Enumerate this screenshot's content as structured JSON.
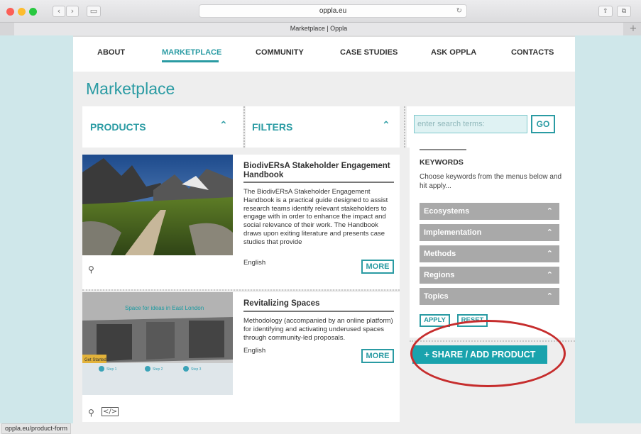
{
  "browser": {
    "url": "oppla.eu",
    "tab_title": "Marketplace | Oppla",
    "back_icon": "‹",
    "forward_icon": "›",
    "sidebar_icon": "▭",
    "reload_icon": "↻",
    "share_icon": "⇪",
    "tabs_icon": "⧉",
    "new_tab_icon": "+"
  },
  "nav": {
    "items": [
      "ABOUT",
      "MARKETPLACE",
      "COMMUNITY",
      "CASE STUDIES",
      "ASK OPPLA",
      "CONTACTS"
    ],
    "active": "MARKETPLACE"
  },
  "page_title": "Marketplace",
  "panels": {
    "products_label": "PRODUCTS",
    "filters_label": "FILTERS",
    "chevron": "⌃"
  },
  "search": {
    "placeholder": "enter search terms:",
    "go_label": "GO"
  },
  "products": [
    {
      "title": "BiodivERsA Stakeholder Engagement Handbook",
      "description": "The BiodivERsA Stakeholder Engagement Handbook is a practical guide designed to assist research teams identify relevant stakeholders to engage with in order to enhance the impact and social relevance of their work. The Handbook draws upon exiting literature and presents case studies that provide",
      "language": "English",
      "more_label": "MORE",
      "icons": [
        "signpost-icon"
      ]
    },
    {
      "title": "Revitalizing Spaces",
      "description": "Methodology (accompanied by an online platform) for identifying and activating underused spaces through community-led proposals.",
      "language": "English",
      "more_label": "MORE",
      "icons": [
        "signpost-icon",
        "code-icon"
      ],
      "image_caption": "Space for ideas in East London",
      "image_tag": "Get Started",
      "image_steps": [
        "Step 1",
        "Step 2",
        "Step 3"
      ]
    }
  ],
  "keywords": {
    "title": "KEYWORDS",
    "description": "Choose keywords from the menus below and hit apply...",
    "categories": [
      "Ecosystems",
      "Implementation",
      "Methods",
      "Regions",
      "Topics"
    ],
    "apply_label": "APPLY",
    "reset_label": "RESET"
  },
  "share_button_label": "+ SHARE / ADD PRODUCT",
  "status_url": "oppla.eu/product-form",
  "colors": {
    "accent": "#2a9ba3",
    "share_button": "#1aa3ad",
    "annotation_ring": "#c62d2d",
    "accordion": "#a9a9a9"
  }
}
